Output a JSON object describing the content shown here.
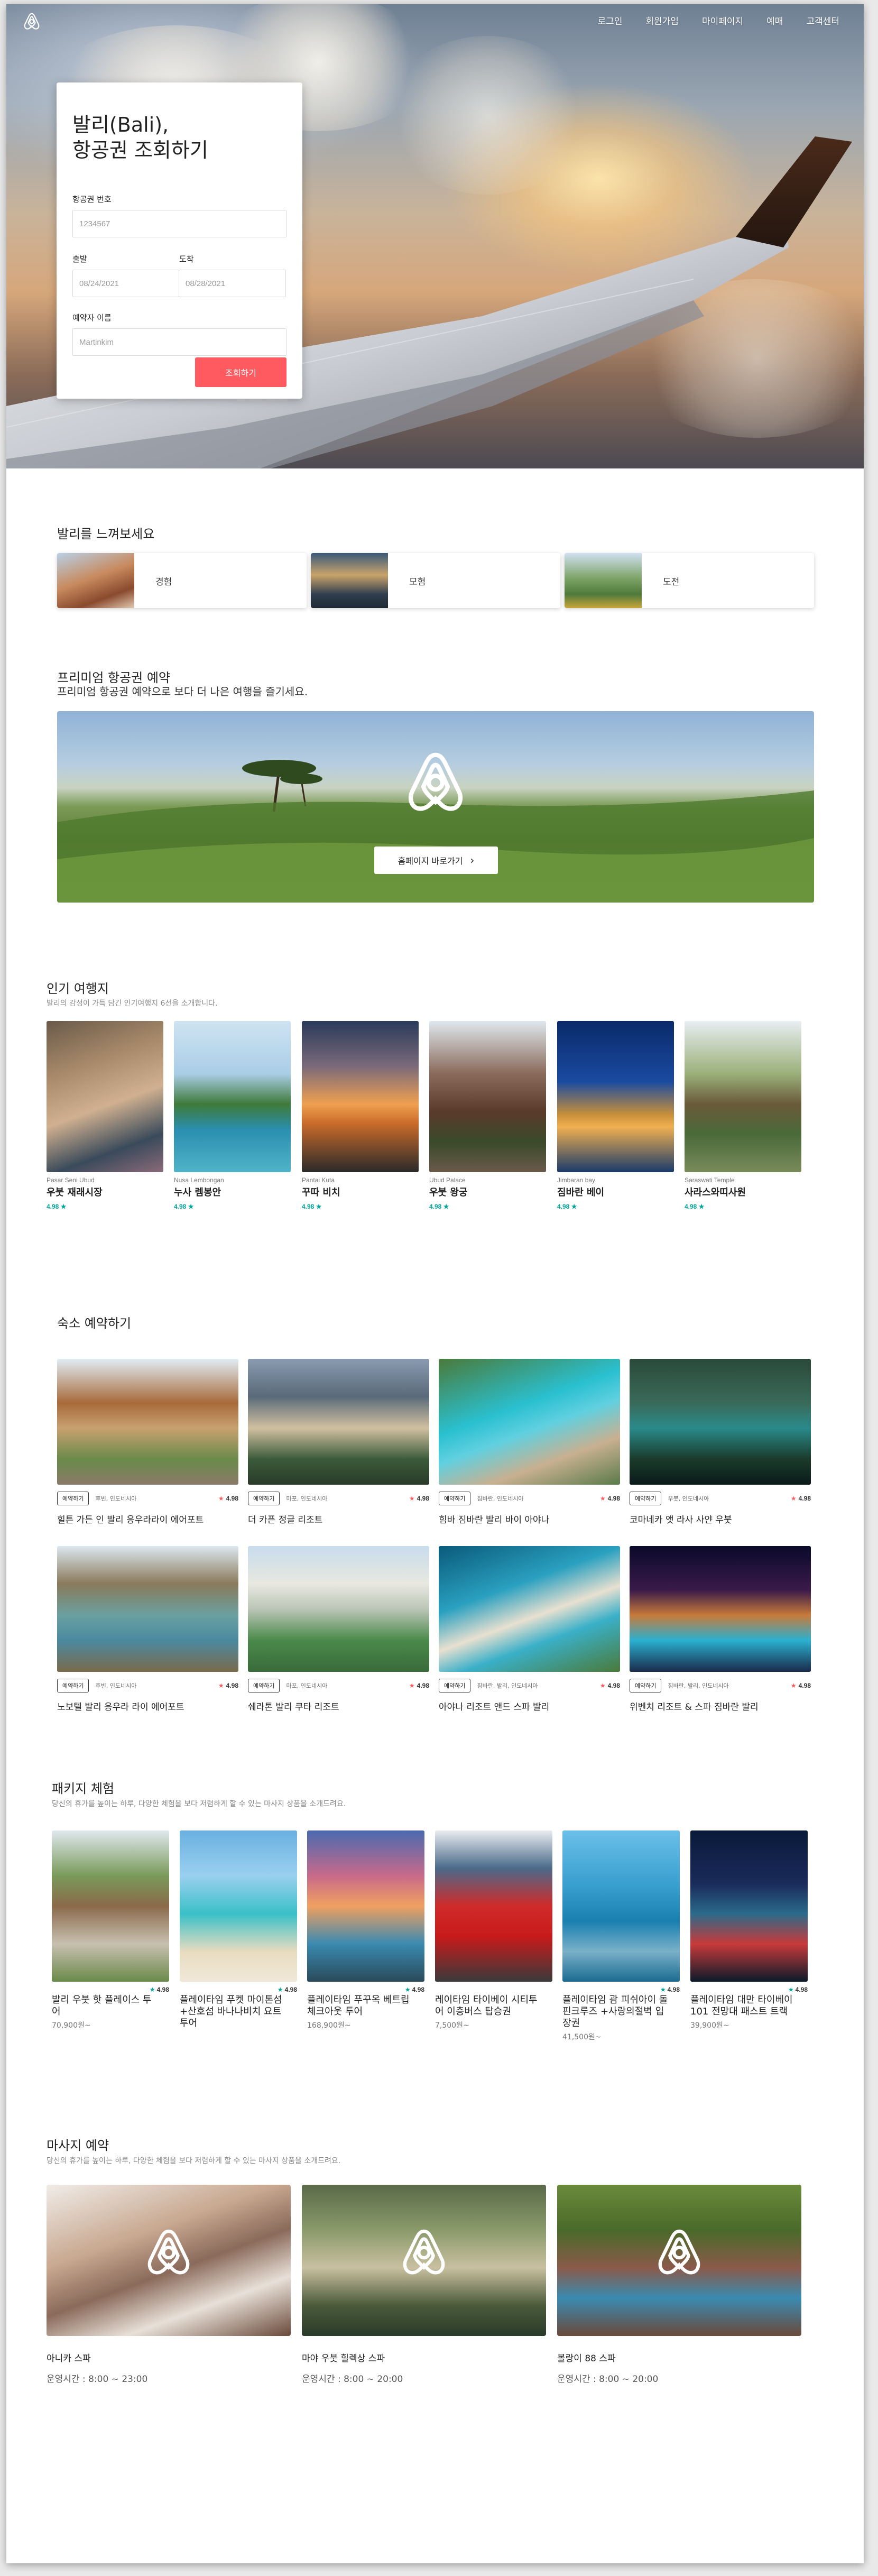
{
  "nav": {
    "items": [
      "로그인",
      "회원가입",
      "마이페이지",
      "예매",
      "고객센터"
    ]
  },
  "booking": {
    "title_line1": "발리(Bali),",
    "title_line2": "항공권 조회하기",
    "ticket_label": "항공권 번호",
    "ticket_placeholder": "1234567",
    "depart_label": "출발",
    "depart_placeholder": "08/24/2021",
    "arrive_label": "도착",
    "arrive_placeholder": "08/28/2021",
    "name_label": "예약자 이름",
    "name_placeholder": "Martinkim",
    "submit": "조회하기"
  },
  "feel": {
    "title": "발리를 느껴보세요",
    "items": [
      "경험",
      "모험",
      "도전"
    ]
  },
  "premium": {
    "title": "프리미엄 항공권 예약",
    "subtitle": "프리미엄 항공권 예약으로 보다 더 나은 여행을 즐기세요.",
    "button": "홈페이지 바로가기"
  },
  "popular": {
    "title": "인기 여행지",
    "subtitle": "발리의 감성이 가득 담긴 인기여행지 6선을 소개합니다.",
    "items": [
      {
        "en": "Pasar Seni Ubud",
        "ko": "우붓 재래시장",
        "rating": "4.98 ★"
      },
      {
        "en": "Nusa Lembongan",
        "ko": "누사 렘봉안",
        "rating": "4.98 ★"
      },
      {
        "en": "Pantai Kuta",
        "ko": "꾸따 비치",
        "rating": "4.98 ★"
      },
      {
        "en": "Ubud Palace",
        "ko": "우붓 왕궁",
        "rating": "4.98 ★"
      },
      {
        "en": "Jimbaran bay",
        "ko": "짐바란 베이",
        "rating": "4.98 ★"
      },
      {
        "en": "Saraswati Temple",
        "ko": "사라스와띠사원",
        "rating": "4.98 ★"
      }
    ]
  },
  "stay": {
    "title": "숙소 예약하기",
    "tag": "예약하기",
    "items": [
      {
        "loc": "후빈, 인도네시아",
        "rating": "4.98",
        "name": "힐튼 가든 인 발리 응우라라이 에어포트"
      },
      {
        "loc": "마포, 인도네시아",
        "rating": "4.98",
        "name": "더 카픈 정글 리조트"
      },
      {
        "loc": "짐바란, 인도네시아",
        "rating": "4.98",
        "name": "힘바 짐바란 발리 바이 아야나"
      },
      {
        "loc": "우붓, 인도네시아",
        "rating": "4.98",
        "name": "코마네카 앳 라사 사얀 우붓"
      },
      {
        "loc": "후빈, 인도네시아",
        "rating": "4.98",
        "name": "노보텔 발리 응우라 라이 에어포트"
      },
      {
        "loc": "마포, 인도네시아",
        "rating": "4.98",
        "name": "쉐라톤 발리 쿠타 리조트"
      },
      {
        "loc": "짐바란, 발리, 인도네시아",
        "rating": "4.98",
        "name": "아야나 리조트 앤드 스파 발리"
      },
      {
        "loc": "짐바란, 발리, 인도네시아",
        "rating": "4.98",
        "name": "위벤치 리조트 & 스파 짐바란 발리"
      }
    ]
  },
  "package": {
    "title": "패키지 체험",
    "subtitle": "당신의 휴가를 높이는 하루, 다양한 체험을 보다 저렴하게 할 수 있는 마사지 상품을 소개드려요.",
    "items": [
      {
        "rating": "4.98",
        "name": "발리 우붓 핫 플레이스 투어",
        "price": "70,900원~"
      },
      {
        "rating": "4.98",
        "name": "플레이타임 푸켓 마이톤섬+산호섬 바나나비치 요트투어",
        "price": ""
      },
      {
        "rating": "4.98",
        "name": "플레이타임 푸꾸옥 베트립 체크아웃 투어",
        "price": "168,900원~"
      },
      {
        "rating": "",
        "name": "레이타임 타이베이 시티투어 이층버스 탑승권",
        "price": "7,500원~"
      },
      {
        "rating": "4.98",
        "name": "플레이타임 괌 피쉬아이 돌핀크루즈 +사랑의절벽 입장권",
        "price": "41,500원~"
      },
      {
        "rating": "4.98",
        "name": "플레이타임 대만 타이베이 101 전망대 패스트 트랙",
        "price": "39,900원~"
      }
    ]
  },
  "massage": {
    "title": "마사지 예약",
    "subtitle": "당신의 휴가를 높이는 하루, 다양한 체험을 보다 저렴하게 할 수 있는 마사지 상품을 소개드려요.",
    "items": [
      {
        "name": "아니카 스파",
        "hours": "운영시간 : 8:00 ~ 23:00"
      },
      {
        "name": "마야 우붓 힐렉상 스파",
        "hours": "운영시간 : 8:00 ~ 20:00"
      },
      {
        "name": "볼랑이 88 스파",
        "hours": "운영시간 : 8:00 ~ 20:00"
      }
    ]
  },
  "colors": {
    "accent": "#ff5a5f",
    "rating": "#00a699"
  }
}
